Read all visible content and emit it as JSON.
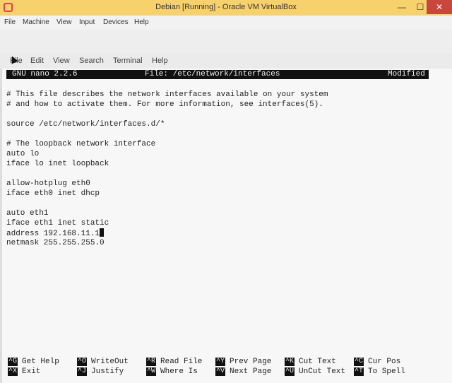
{
  "window": {
    "title": "Debian [Running] - Oracle VM VirtualBox",
    "minimize": "—",
    "maximize": "☐",
    "close": "✕"
  },
  "vm_menu": [
    "File",
    "Machine",
    "View",
    "Input",
    "Devices",
    "Help"
  ],
  "terminal_menu": [
    "File",
    "Edit",
    "View",
    "Search",
    "Terminal",
    "Help"
  ],
  "nano": {
    "version": "GNU nano 2.2.6",
    "file": "File: /etc/network/interfaces",
    "status": "Modified"
  },
  "file_lines": [
    "# This file describes the network interfaces available on your system",
    "# and how to activate them. For more information, see interfaces(5).",
    "",
    "source /etc/network/interfaces.d/*",
    "",
    "# The loopback network interface",
    "auto lo",
    "iface lo inet loopback",
    "",
    "allow-hotplug eth0",
    "iface eth0 inet dhcp",
    "",
    "auto eth1",
    "iface eth1 inet static",
    "address 192.168.11.1",
    "netmask 255.255.255.0"
  ],
  "shortcuts": [
    [
      {
        "key": "^G",
        "label": "Get Help"
      },
      {
        "key": "^O",
        "label": "WriteOut"
      },
      {
        "key": "^R",
        "label": "Read File"
      },
      {
        "key": "^Y",
        "label": "Prev Page"
      },
      {
        "key": "^K",
        "label": "Cut Text"
      },
      {
        "key": "^C",
        "label": "Cur Pos"
      }
    ],
    [
      {
        "key": "^X",
        "label": "Exit"
      },
      {
        "key": "^J",
        "label": "Justify"
      },
      {
        "key": "^W",
        "label": "Where Is"
      },
      {
        "key": "^V",
        "label": "Next Page"
      },
      {
        "key": "^U",
        "label": "UnCut Text"
      },
      {
        "key": "^T",
        "label": "To Spell"
      }
    ]
  ]
}
